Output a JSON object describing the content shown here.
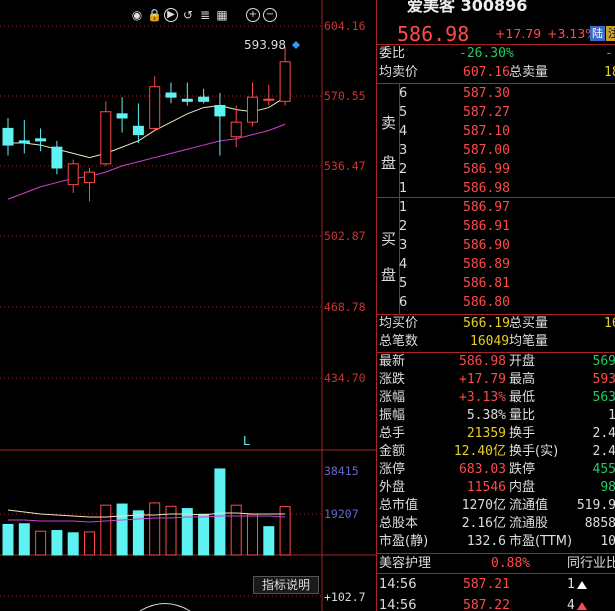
{
  "stock": {
    "title": "爱美客 300896",
    "price": "586.98",
    "change": "+17.79",
    "change_pct": "+3.13%",
    "tag_lu": "陆",
    "tag_zhu": "注"
  },
  "toolbar_icons": [
    "eye-icon",
    "lock-icon",
    "replay-icon",
    "undo-icon",
    "list-icon",
    "grid-icon",
    "zoom-in-icon",
    "zoom-out-icon"
  ],
  "price_axis": [
    "604.16",
    "570.55",
    "536.47",
    "502.87",
    "468.78",
    "434.70"
  ],
  "volume_axis": [
    "38415",
    "19207"
  ],
  "sub_axis": "+102.7",
  "peak_label": "593.98",
  "l_marker": "L",
  "hint_button": "指标说明",
  "weibi": {
    "label": "委比",
    "value": "-26.30%",
    "extra": "-"
  },
  "junmai": {
    "label": "均卖价",
    "value": "607.16",
    "label2": "总卖量",
    "value2": "18"
  },
  "sell_side_label": [
    "卖",
    "盘"
  ],
  "buy_side_label": [
    "买",
    "盘"
  ],
  "sell": [
    {
      "level": "6",
      "price": "587.30"
    },
    {
      "level": "5",
      "price": "587.27"
    },
    {
      "level": "4",
      "price": "587.10"
    },
    {
      "level": "3",
      "price": "587.00"
    },
    {
      "level": "2",
      "price": "586.99"
    },
    {
      "level": "1",
      "price": "586.98"
    }
  ],
  "buy": [
    {
      "level": "1",
      "price": "586.97"
    },
    {
      "level": "2",
      "price": "586.91"
    },
    {
      "level": "3",
      "price": "586.90"
    },
    {
      "level": "4",
      "price": "586.89"
    },
    {
      "level": "5",
      "price": "586.81"
    },
    {
      "level": "6",
      "price": "586.80"
    }
  ],
  "junmai_buy": {
    "label": "均买价",
    "value": "566.19",
    "label2": "总买量",
    "value2": "16"
  },
  "total_trades": {
    "label": "总笔数",
    "value": "16049",
    "label2": "均笔量"
  },
  "stats": [
    {
      "l1": "最新",
      "v1": "586.98",
      "c1": "red",
      "l2": "开盘",
      "v2": "569",
      "c2": "green"
    },
    {
      "l1": "涨跌",
      "v1": "+17.79",
      "c1": "red",
      "l2": "最高",
      "v2": "593",
      "c2": "red"
    },
    {
      "l1": "涨幅",
      "v1": "+3.13%",
      "c1": "red",
      "l2": "最低",
      "v2": "563",
      "c2": "green"
    },
    {
      "l1": "振幅",
      "v1": "5.38%",
      "c1": "white",
      "l2": "量比",
      "v2": "1",
      "c2": "white"
    },
    {
      "l1": "总手",
      "v1": "21359",
      "c1": "yellow",
      "l2": "换手",
      "v2": "2.4",
      "c2": "white"
    },
    {
      "l1": "金额",
      "v1": "12.40亿",
      "c1": "yellow",
      "l2": "换手(实)",
      "v2": "2.4",
      "c2": "white"
    },
    {
      "l1": "涨停",
      "v1": "683.03",
      "c1": "red",
      "l2": "跌停",
      "v2": "455",
      "c2": "green"
    },
    {
      "l1": "外盘",
      "v1": "11546",
      "c1": "red",
      "l2": "内盘",
      "v2": "98",
      "c2": "green"
    },
    {
      "l1": "总市值",
      "v1": "1270亿",
      "c1": "white",
      "l2": "流通值",
      "v2": "519.9",
      "c2": "white"
    },
    {
      "l1": "总股本",
      "v1": "2.16亿",
      "c1": "white",
      "l2": "流通股",
      "v2": "8858",
      "c2": "white"
    },
    {
      "l1": "市盈(静)",
      "v1": "132.6",
      "c1": "white",
      "l2": "市盈(TTM)",
      "v2": "10",
      "c2": "white"
    }
  ],
  "industry": {
    "name": "美容护理",
    "pct": "0.88%",
    "label2": "同行业比"
  },
  "ticks": [
    {
      "time": "14:56",
      "price": "587.21",
      "vol": "1",
      "dir": "up-white"
    },
    {
      "time": "14:56",
      "price": "587.22",
      "vol": "4",
      "dir": "up-red"
    }
  ],
  "colors": {
    "up": "#ff4a4a",
    "down": "#22cc66",
    "cyan": "#5ff2f2",
    "grid": "#aa2222"
  },
  "chart_data": {
    "type": "candlestick",
    "ylim": [
      434.7,
      604.16
    ],
    "candles": [
      {
        "o": 555,
        "c": 547,
        "h": 560,
        "l": 542
      },
      {
        "o": 549,
        "c": 548,
        "h": 559,
        "l": 543
      },
      {
        "o": 550,
        "c": 549,
        "h": 555,
        "l": 544
      },
      {
        "o": 546,
        "c": 536,
        "h": 549,
        "l": 533
      },
      {
        "o": 528,
        "c": 538,
        "h": 540,
        "l": 524
      },
      {
        "o": 529,
        "c": 534,
        "h": 536,
        "l": 520
      },
      {
        "o": 538,
        "c": 563,
        "h": 568,
        "l": 537
      },
      {
        "o": 562,
        "c": 560,
        "h": 570,
        "l": 553
      },
      {
        "o": 556,
        "c": 552,
        "h": 567,
        "l": 548
      },
      {
        "o": 555,
        "c": 575,
        "h": 580,
        "l": 554
      },
      {
        "o": 572,
        "c": 570,
        "h": 577,
        "l": 567
      },
      {
        "o": 569,
        "c": 568,
        "h": 577,
        "l": 566
      },
      {
        "o": 570,
        "c": 568,
        "h": 574,
        "l": 567
      },
      {
        "o": 566,
        "c": 561,
        "h": 572,
        "l": 542
      },
      {
        "o": 551,
        "c": 558,
        "h": 566,
        "l": 546
      },
      {
        "o": 558,
        "c": 570,
        "h": 577,
        "l": 556
      },
      {
        "o": 569,
        "c": 569,
        "h": 576,
        "l": 566
      },
      {
        "o": 568,
        "c": 587,
        "h": 594,
        "l": 566
      }
    ],
    "ma_short": [
      548,
      548,
      547,
      545,
      543,
      541,
      543,
      546,
      549,
      554,
      558,
      562,
      565,
      566,
      564,
      563,
      565,
      570
    ],
    "ma_long": [
      521,
      524,
      527,
      529,
      531,
      532,
      534,
      537,
      539,
      541,
      543,
      545,
      547,
      549,
      550,
      552,
      554,
      557
    ],
    "volumes": [
      13500,
      13800,
      10500,
      10800,
      9800,
      10200,
      22000,
      22500,
      19500,
      23000,
      21500,
      20500,
      18000,
      38000,
      22000,
      18000,
      12500,
      21359
    ],
    "volume_up": [
      false,
      false,
      true,
      false,
      false,
      true,
      true,
      false,
      false,
      true,
      true,
      false,
      false,
      false,
      true,
      true,
      false,
      true
    ],
    "vol_axis_max": 38415
  }
}
